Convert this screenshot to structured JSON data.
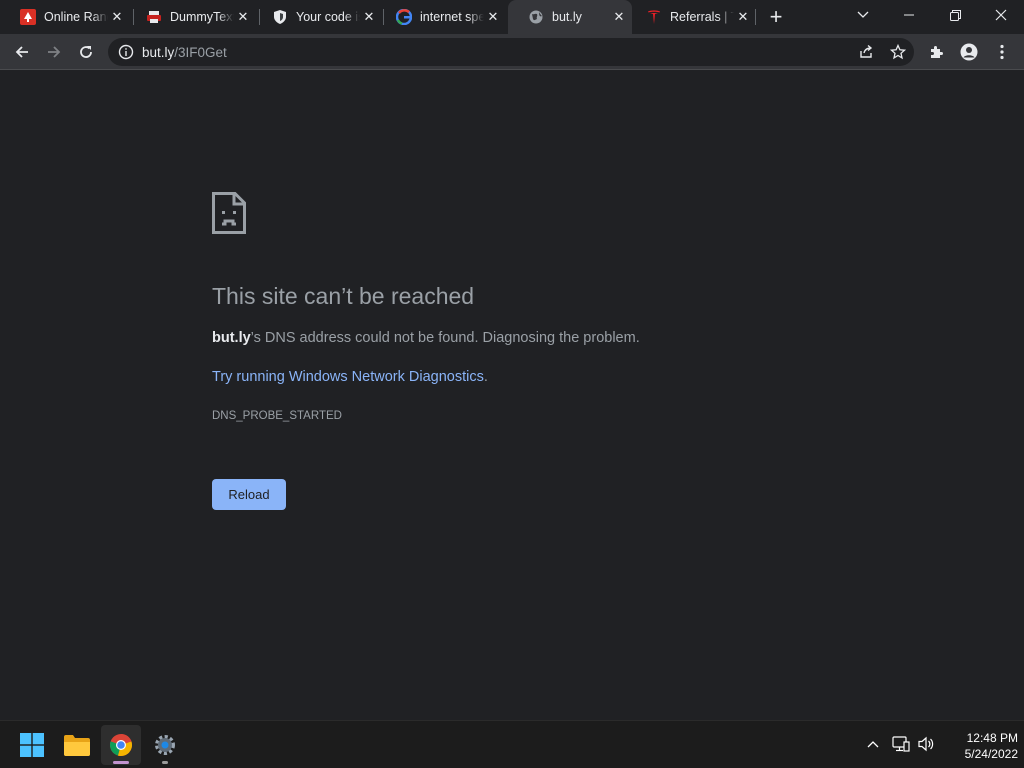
{
  "tabs": [
    {
      "title": "Online Random",
      "favicon": "tree-favicon",
      "color": "#d93025"
    },
    {
      "title": "DummyText",
      "favicon": "printer-favicon",
      "color": "#e8eaed"
    },
    {
      "title": "Your code is",
      "favicon": "shield-favicon",
      "color": "#e8eaed"
    },
    {
      "title": "internet speed",
      "favicon": "google-favicon",
      "color": "#4285f4"
    },
    {
      "title": "but.ly",
      "favicon": "globe-favicon",
      "color": "#9aa0a6",
      "active": true
    },
    {
      "title": "Referrals | Tesla",
      "favicon": "tesla-favicon",
      "color": "#e82127"
    }
  ],
  "toolbar": {
    "url_host": "but.ly",
    "url_path": "/3IF0Get"
  },
  "error": {
    "heading": "This site can’t be reached",
    "host": "but.ly",
    "description": "’s DNS address could not be found. Diagnosing the problem.",
    "suggestion_link": "Try running Windows Network Diagnostics",
    "suggestion_end": ".",
    "code": "DNS_PROBE_STARTED",
    "reload_label": "Reload"
  },
  "taskbar": {
    "time": "12:48 PM",
    "date": "5/24/2022"
  },
  "colors": {
    "accent": "#8ab4f8",
    "background": "#202124",
    "toolbar": "#35363a"
  }
}
